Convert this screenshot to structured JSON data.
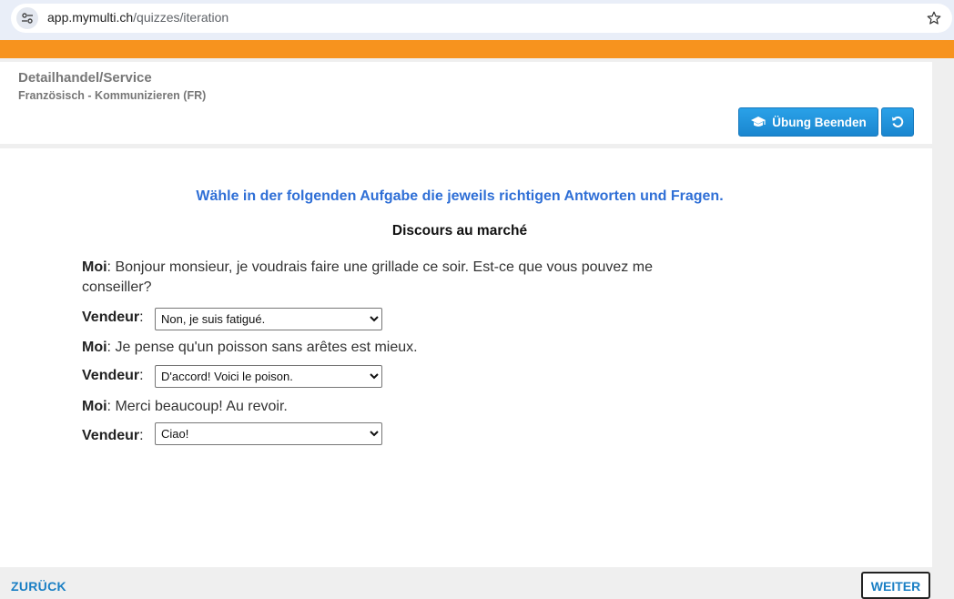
{
  "browser": {
    "url_host": "app.mymulti.ch",
    "url_path": "/quizzes/iteration"
  },
  "header": {
    "title": "Detailhandel/Service",
    "subtitle": "Französisch - Kommunizieren (FR)",
    "end_button_label": "Übung Beenden"
  },
  "quiz": {
    "instruction": "Wähle in der folgenden Aufgabe die jeweils richtigen Antworten und Fragen.",
    "title": "Discours au marché",
    "speaker_me": "Moi",
    "speaker_vendor": "Vendeur",
    "lines": [
      {
        "text_1": ": Bonjour monsieur, je voudrais faire une grillade ce soir. Est-ce que vous pouvez me",
        "text_2": "conseiller?"
      },
      {
        "text_1": ": Je pense qu'un poisson sans arêtes est mieux."
      },
      {
        "text_1": ": Merci beaucoup! Au revoir."
      }
    ],
    "answers": [
      {
        "selected": "Non, je suis fatigué."
      },
      {
        "selected": "D'accord! Voici le poison."
      },
      {
        "selected": "Ciao!"
      }
    ]
  },
  "nav": {
    "back_label": "ZURÜCK",
    "next_label": "WEITER"
  },
  "colors": {
    "orange_banner": "#f7931e",
    "button_blue": "#1a86cf",
    "instruction_blue": "#2f6fd6",
    "nav_blue": "#1a7fc4"
  }
}
